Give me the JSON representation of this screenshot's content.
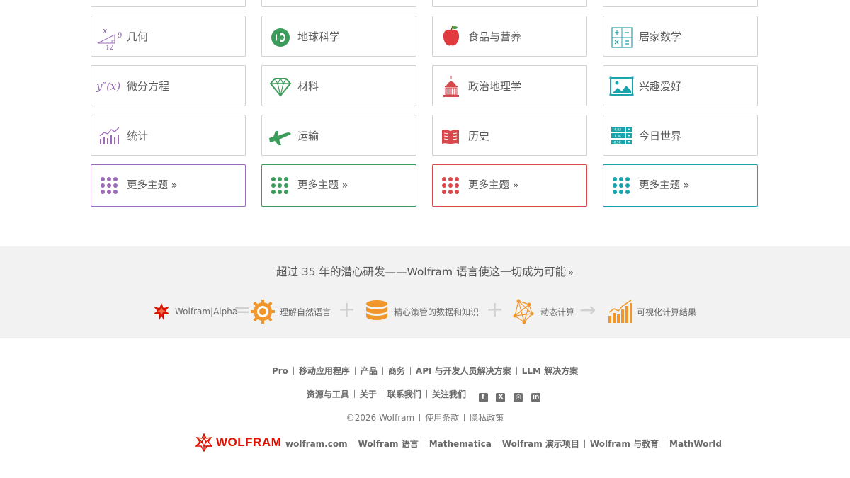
{
  "topics": {
    "row0": [
      {
        "label": "几何",
        "icon": "geometry-icon"
      },
      {
        "label": "地球科学",
        "icon": "earth-science-icon"
      },
      {
        "label": "食品与营养",
        "icon": "apple-icon"
      },
      {
        "label": "居家数学",
        "icon": "calculator-icon"
      }
    ],
    "row1": [
      {
        "label": "微分方程",
        "icon": "differential-equation-icon"
      },
      {
        "label": "材料",
        "icon": "diamond-icon"
      },
      {
        "label": "政治地理学",
        "icon": "capitol-icon"
      },
      {
        "label": "兴趣爱好",
        "icon": "picture-icon"
      }
    ],
    "row2": [
      {
        "label": "统计",
        "icon": "statistics-chart-icon"
      },
      {
        "label": "运输",
        "icon": "airplane-icon"
      },
      {
        "label": "历史",
        "icon": "book-icon"
      },
      {
        "label": "今日世界",
        "icon": "stock-ticker-icon"
      }
    ],
    "more_label": "更多主题 »",
    "more_colors": [
      "#9b6bb8",
      "#3c9c5c",
      "#d8484d",
      "#1aa5ac"
    ],
    "geometry_numbers": {
      "x": "x",
      "nine": "9",
      "twelve": "12"
    },
    "ode_text": "y″(x)",
    "ticker_values": [
      "4.83",
      "1.3K",
      "-0.5K"
    ]
  },
  "band": {
    "headline": "超过 35 年的潜心研发——Wolfram 语言使这一切成为可能",
    "headline_arrow": "»",
    "items": [
      {
        "label": "Wolfram|Alpha",
        "icon": "wolfram-alpha-logo-icon"
      },
      {
        "label": "理解自然语言",
        "icon": "gear-sun-icon"
      },
      {
        "label": "精心策管的数据和知识",
        "icon": "database-icon"
      },
      {
        "label": "动态计算",
        "icon": "network-icon"
      },
      {
        "label": "可视化计算结果",
        "icon": "bar-chart-icon"
      }
    ],
    "ops": [
      "=",
      "+",
      "+",
      "→"
    ],
    "accent": "#f0962a"
  },
  "footer": {
    "row1": [
      "Pro",
      "移动应用程序",
      "产品",
      "商务",
      "API 与开发人员解决方案",
      "LLM 解决方案"
    ],
    "row2": [
      "资源与工具",
      "关于",
      "联系我们",
      "关注我们"
    ],
    "social": [
      "facebook-icon",
      "x-twitter-icon",
      "instagram-icon",
      "linkedin-icon"
    ],
    "row3": [
      "©2026 Wolfram",
      "使用条款",
      "隐私政策"
    ],
    "brand": "WOLFRAM",
    "row4": [
      "wolfram.com",
      "Wolfram 语言",
      "Mathematica",
      "Wolfram 演示项目",
      "Wolfram 与教育",
      "MathWorld"
    ],
    "brand_color": "#dd1100"
  }
}
